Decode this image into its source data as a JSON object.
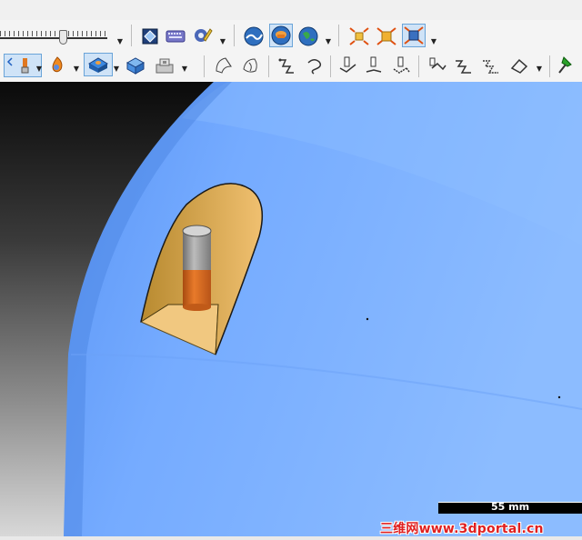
{
  "scale_bar": {
    "label": "55 mm"
  },
  "watermark": {
    "text": "三维网www.3dportal.cn"
  },
  "colors": {
    "surface_blue": "#6ea6ff",
    "pocket_gold": "#e8b55a",
    "pin_orange": "#d8661e",
    "pin_gray": "#9a9a9a"
  },
  "toolbar_row1": [
    {
      "name": "slider",
      "kind": "zoom-slider"
    },
    {
      "name": "view-orient-icon"
    },
    {
      "name": "keyboard-icon"
    },
    {
      "name": "settings-wrench-icon"
    },
    {
      "name": "wave-shading-icon"
    },
    {
      "name": "solid-shading-icon",
      "active": true
    },
    {
      "name": "globe-render-icon"
    },
    {
      "name": "explode-icon-1"
    },
    {
      "name": "explode-icon-2"
    },
    {
      "name": "explode-icon-3",
      "active": true
    }
  ],
  "toolbar_row2": [
    {
      "name": "tool-probe-icon",
      "active": true
    },
    {
      "name": "flame-shading-icon"
    },
    {
      "name": "stock-view-icon",
      "active": true
    },
    {
      "name": "part-view-icon"
    },
    {
      "name": "fixture-icon"
    },
    {
      "name": "section-icon-1"
    },
    {
      "name": "section-icon-2"
    },
    {
      "name": "curve-icon-1"
    },
    {
      "name": "curve-icon-2"
    },
    {
      "name": "toolpath-icon-1"
    },
    {
      "name": "toolpath-icon-2"
    },
    {
      "name": "toolpath-icon-3"
    },
    {
      "name": "toolpath-icon-4"
    },
    {
      "name": "toolpath-icon-5"
    },
    {
      "name": "toolpath-icon-6"
    },
    {
      "name": "toolpath-icon-7"
    },
    {
      "name": "pin-icon"
    }
  ]
}
